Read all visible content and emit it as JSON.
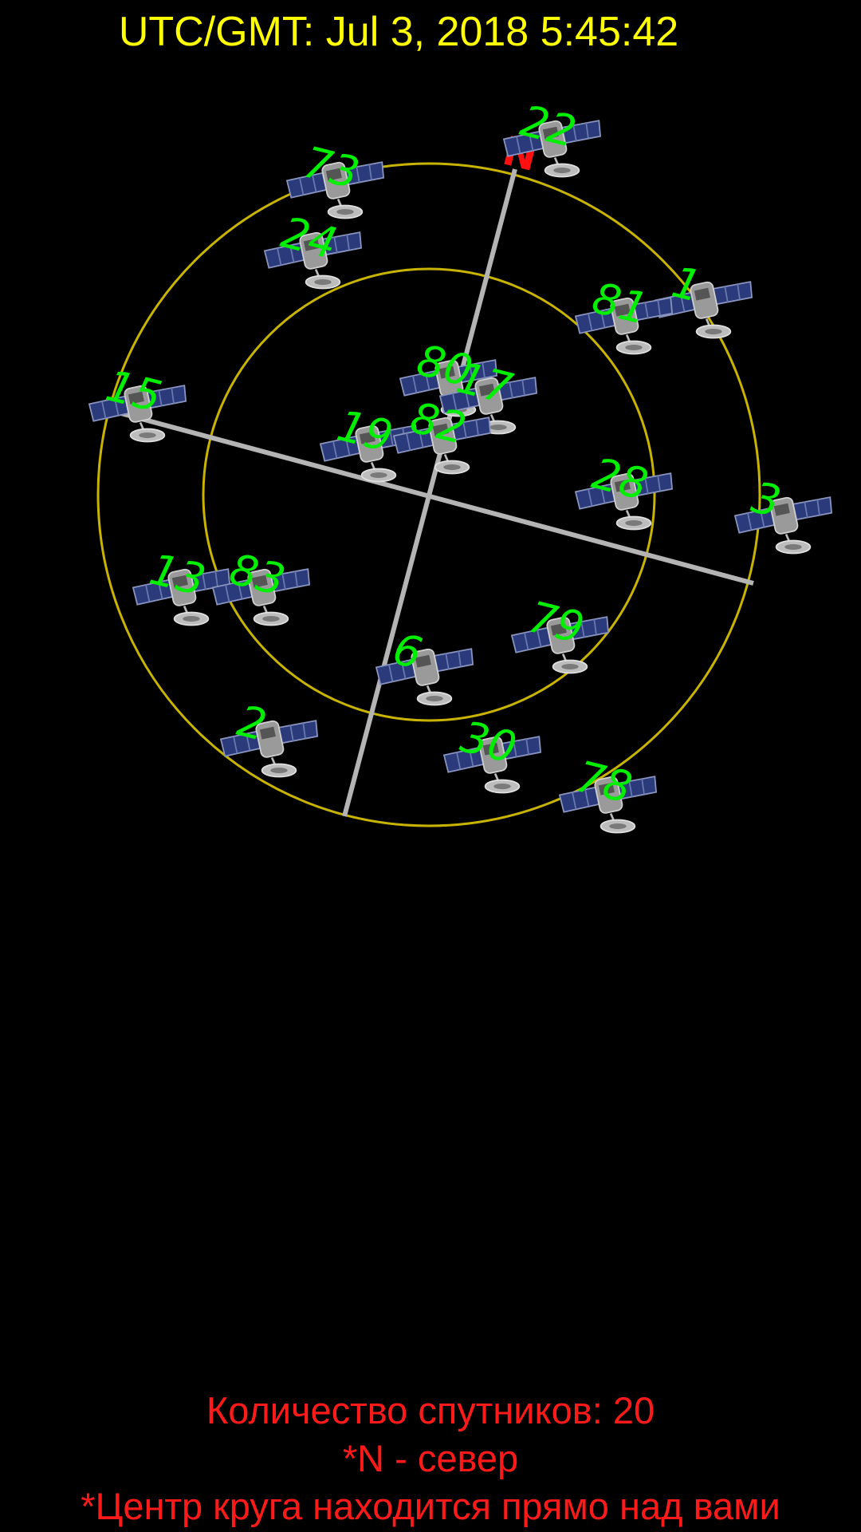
{
  "header": {
    "utc_time": "UTC/GMT: Jul 3, 2018 5:45:42"
  },
  "sky_plot": {
    "north_label": "N",
    "ring_color": "#c8b400",
    "axis_color": "#b4b4b4",
    "label_color": "#00ee00",
    "north_color": "#ff1010",
    "satellites": [
      {
        "prn": "22",
        "icon": "satellite-icon"
      },
      {
        "prn": "73",
        "icon": "satellite-icon"
      },
      {
        "prn": "24",
        "icon": "satellite-icon"
      },
      {
        "prn": "1",
        "icon": "satellite-icon"
      },
      {
        "prn": "81",
        "icon": "satellite-icon"
      },
      {
        "prn": "80",
        "icon": "satellite-icon"
      },
      {
        "prn": "17",
        "icon": "satellite-icon"
      },
      {
        "prn": "15",
        "icon": "satellite-icon"
      },
      {
        "prn": "19",
        "icon": "satellite-icon"
      },
      {
        "prn": "82",
        "icon": "satellite-icon"
      },
      {
        "prn": "28",
        "icon": "satellite-icon"
      },
      {
        "prn": "3",
        "icon": "satellite-icon"
      },
      {
        "prn": "13",
        "icon": "satellite-icon"
      },
      {
        "prn": "83",
        "icon": "satellite-icon"
      },
      {
        "prn": "79",
        "icon": "satellite-icon"
      },
      {
        "prn": "6",
        "icon": "satellite-icon"
      },
      {
        "prn": "2",
        "icon": "satellite-icon"
      },
      {
        "prn": "30",
        "icon": "satellite-icon"
      },
      {
        "prn": "78",
        "icon": "satellite-icon"
      }
    ]
  },
  "footer": {
    "satellite_count": "Количество спутников: 20",
    "north_legend": "*N - север",
    "center_note": "*Центр круга находится прямо над вами"
  }
}
